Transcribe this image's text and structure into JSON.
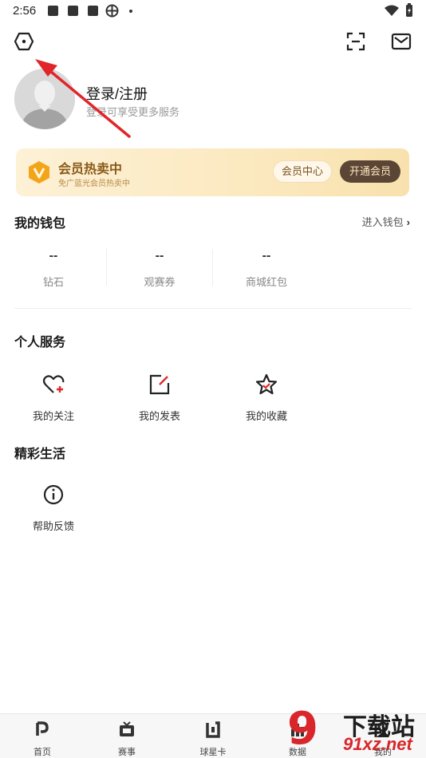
{
  "status_bar": {
    "time": "2:56"
  },
  "profile": {
    "title": "登录/注册",
    "subtitle": "登录可享受更多服务"
  },
  "vip": {
    "title": "会员热卖中",
    "subtitle": "免广蓝光会员热卖中",
    "center_label": "会员中心",
    "open_label": "开通会员",
    "colors": {
      "title": "#8a5a18",
      "button_dark": "#5b4636"
    }
  },
  "wallet": {
    "title": "我的钱包",
    "link_label": "进入钱包",
    "items": [
      {
        "value": "--",
        "label": "钻石"
      },
      {
        "value": "--",
        "label": "观赛券"
      },
      {
        "value": "--",
        "label": "商城红包"
      }
    ]
  },
  "personal_services": {
    "title": "个人服务",
    "items": [
      {
        "label": "我的关注",
        "icon": "heart-plus-icon"
      },
      {
        "label": "我的发表",
        "icon": "edit-square-icon"
      },
      {
        "label": "我的收藏",
        "icon": "star-check-icon"
      }
    ]
  },
  "life": {
    "title": "精彩生活",
    "items": [
      {
        "label": "帮助反馈",
        "icon": "info-circle-icon"
      }
    ]
  },
  "tabbar": {
    "items": [
      {
        "label": "首页",
        "icon": "home-logo-icon"
      },
      {
        "label": "赛事",
        "icon": "tv-icon"
      },
      {
        "label": "球星卡",
        "icon": "card-icon"
      },
      {
        "label": "数据",
        "icon": "bar-chart-icon"
      },
      {
        "label": "我的",
        "icon": "profile-icon"
      }
    ]
  },
  "watermark": {
    "number": "9",
    "text_top": "下载站",
    "text_bottom": "91xz.net"
  },
  "accent_color": "#e0262a"
}
